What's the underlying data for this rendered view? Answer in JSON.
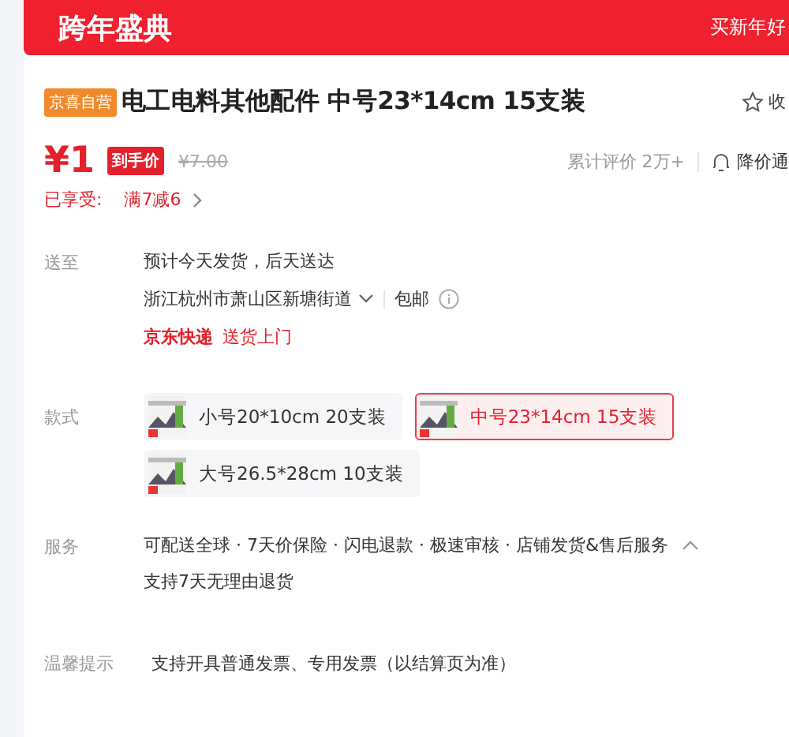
{
  "banner": {
    "title": "跨年盛典",
    "promo": "买新年好"
  },
  "product": {
    "badge": "京喜自营",
    "title": "电工电料其他配件 中号23*14cm 15支装",
    "favorite": "收"
  },
  "price": {
    "current": "¥1",
    "tag": "到手价",
    "original": "¥7.00",
    "reviews": "累计评价 2万+",
    "notify": "降价通"
  },
  "discount": {
    "label": "已享受:",
    "value": "满7减6"
  },
  "delivery": {
    "label": "送至",
    "estimate": "预计今天发货，后天送达",
    "address": "浙江杭州市萧山区新塘街道",
    "shipping": "包邮",
    "carrier": "京东快递",
    "service": "送货上门"
  },
  "variants": {
    "label": "款式",
    "options": [
      {
        "name": "小号20*10cm 20支装",
        "selected": false
      },
      {
        "name": "中号23*14cm 15支装",
        "selected": true
      },
      {
        "name": "大号26.5*28cm 10支装",
        "selected": false
      }
    ]
  },
  "services": {
    "label": "服务",
    "summary": "可配送全球 · 7天价保险 · 闪电退款 · 极速审核 · 店铺发货&售后服务",
    "expanded": true,
    "detail": "支持7天无理由退货"
  },
  "tips": {
    "label": "温馨提示",
    "text": "支持开具普通发票、专用发票（以结算页为准）"
  }
}
